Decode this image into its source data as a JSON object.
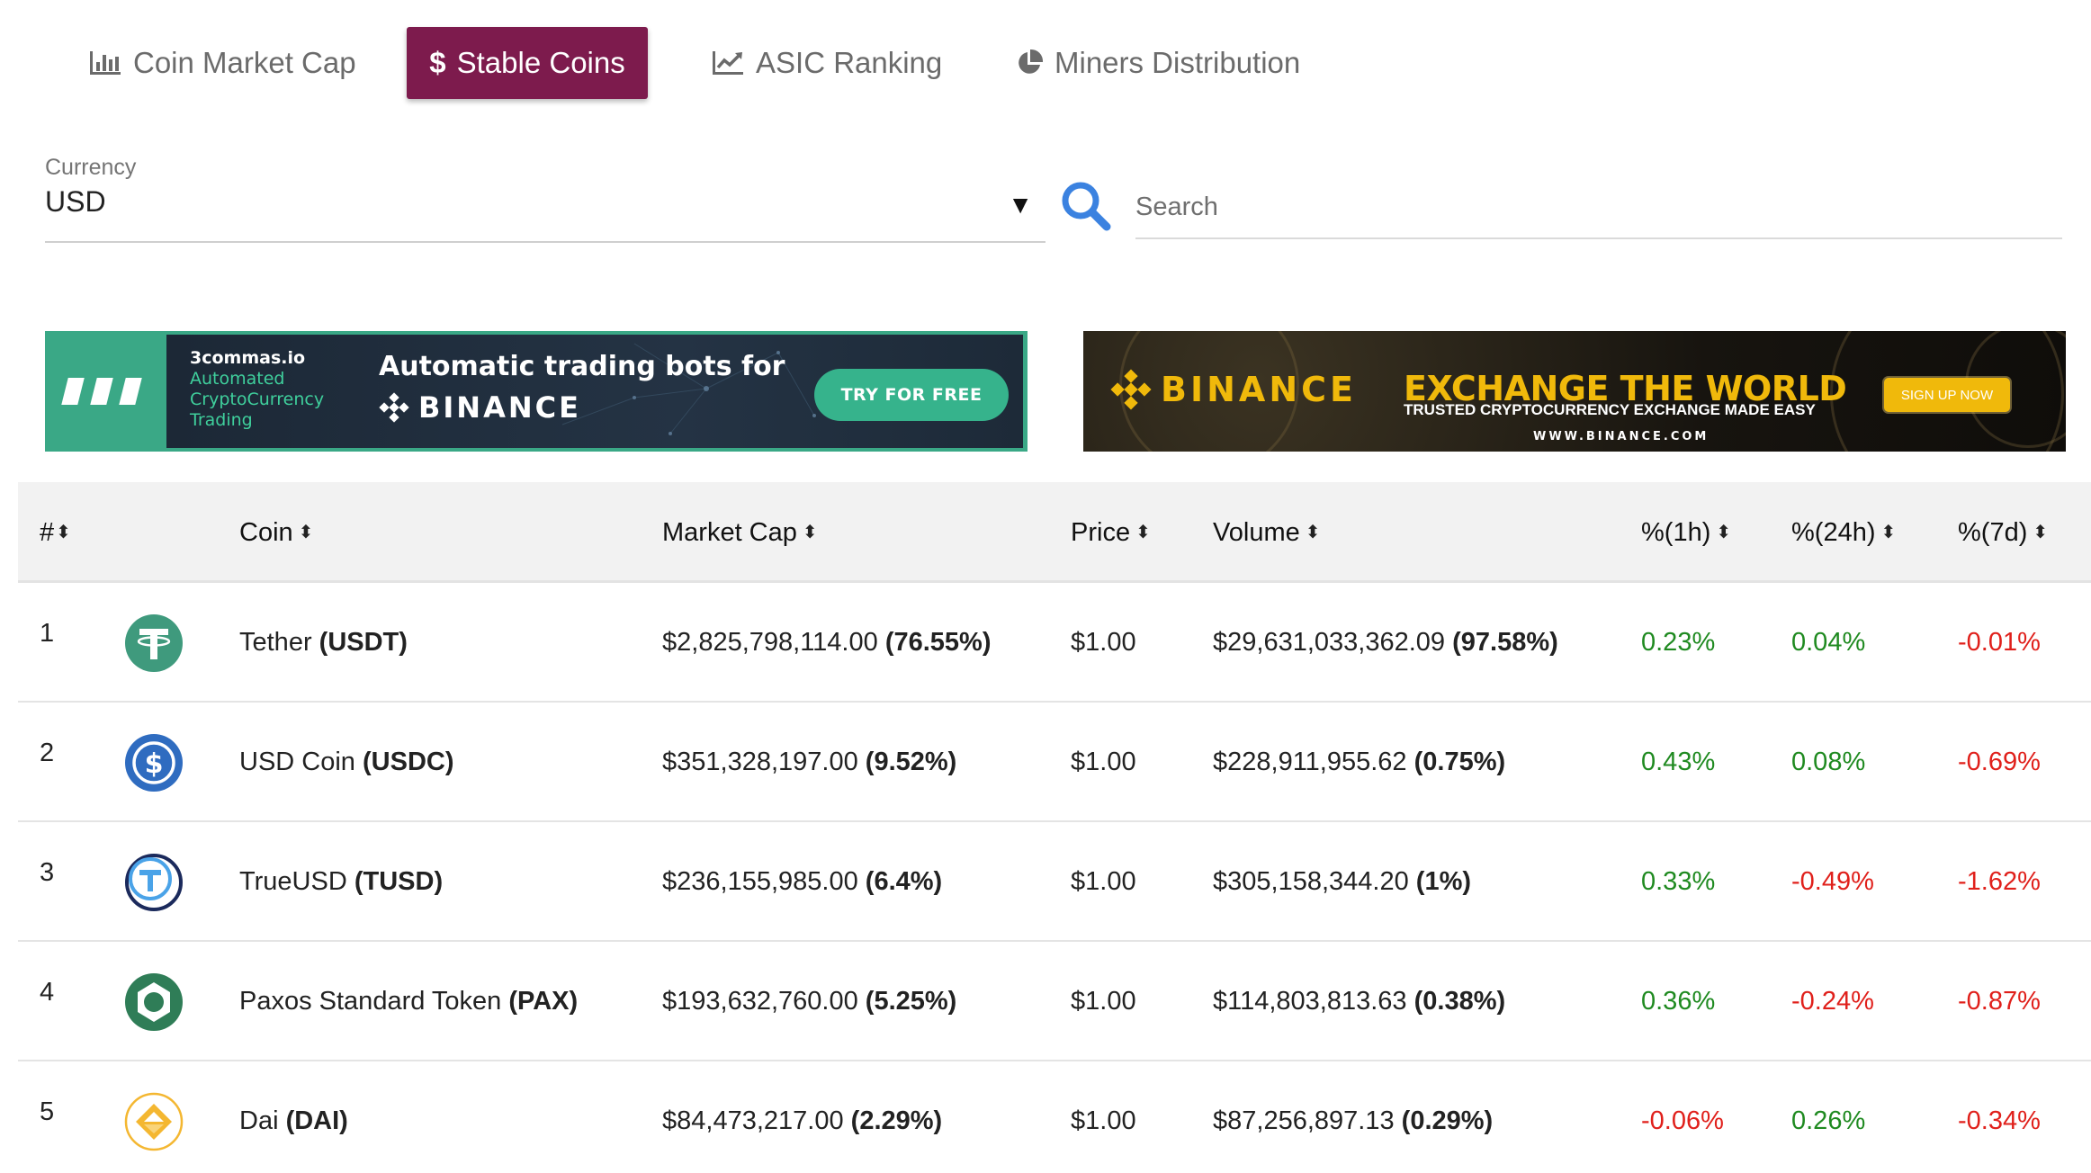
{
  "tabs": [
    {
      "label": "Coin Market Cap",
      "icon": "bar-chart-icon",
      "active": false
    },
    {
      "label": "Stable Coins",
      "icon": "dollar-icon",
      "active": true
    },
    {
      "label": "ASIC Ranking",
      "icon": "line-chart-icon",
      "active": false
    },
    {
      "label": "Miners Distribution",
      "icon": "pie-chart-icon",
      "active": false
    }
  ],
  "currency": {
    "label": "Currency",
    "value": "USD"
  },
  "search": {
    "placeholder": "Search",
    "value": ""
  },
  "ads": {
    "threecommas": {
      "brand": "3commas.io",
      "tagline": "Automated CryptoCurrency Trading",
      "headline": "Automatic trading bots for",
      "partner": "BINANCE",
      "cta": "TRY FOR FREE"
    },
    "binance": {
      "brand": "BINANCE",
      "headline": "EXCHANGE THE WORLD",
      "sub": "TRUSTED CRYPTOCURRENCY EXCHANGE MADE EASY",
      "site": "WWW.BINANCE.COM",
      "cta": "SIGN UP NOW"
    }
  },
  "table": {
    "headers": {
      "rank": "#",
      "coin": "Coin",
      "market_cap": "Market Cap",
      "price": "Price",
      "volume": "Volume",
      "h1": "%(1h)",
      "h24": "%(24h)",
      "d7": "%(7d)"
    },
    "rows": [
      {
        "rank": "1",
        "name": "Tether",
        "symbol": "(USDT)",
        "logo": "tether-icon",
        "market_cap": "$2,825,798,114.00",
        "market_cap_pct": "(76.55%)",
        "price": "$1.00",
        "volume": "$29,631,033,362.09",
        "volume_pct": "(97.58%)",
        "h1": "0.23%",
        "h24": "0.04%",
        "d7": "-0.01%"
      },
      {
        "rank": "2",
        "name": "USD Coin",
        "symbol": "(USDC)",
        "logo": "usd-coin-icon",
        "market_cap": "$351,328,197.00",
        "market_cap_pct": "(9.52%)",
        "price": "$1.00",
        "volume": "$228,911,955.62",
        "volume_pct": "(0.75%)",
        "h1": "0.43%",
        "h24": "0.08%",
        "d7": "-0.69%"
      },
      {
        "rank": "3",
        "name": "TrueUSD",
        "symbol": "(TUSD)",
        "logo": "trueusd-icon",
        "market_cap": "$236,155,985.00",
        "market_cap_pct": "(6.4%)",
        "price": "$1.00",
        "volume": "$305,158,344.20",
        "volume_pct": "(1%)",
        "h1": "0.33%",
        "h24": "-0.49%",
        "d7": "-1.62%"
      },
      {
        "rank": "4",
        "name": "Paxos Standard Token",
        "symbol": "(PAX)",
        "logo": "paxos-icon",
        "market_cap": "$193,632,760.00",
        "market_cap_pct": "(5.25%)",
        "price": "$1.00",
        "volume": "$114,803,813.63",
        "volume_pct": "(0.38%)",
        "h1": "0.36%",
        "h24": "-0.24%",
        "d7": "-0.87%"
      },
      {
        "rank": "5",
        "name": "Dai",
        "symbol": "(DAI)",
        "logo": "dai-icon",
        "market_cap": "$84,473,217.00",
        "market_cap_pct": "(2.29%)",
        "price": "$1.00",
        "volume": "$87,256,897.13",
        "volume_pct": "(0.29%)",
        "h1": "-0.06%",
        "h24": "0.26%",
        "d7": "-0.34%"
      }
    ]
  },
  "colors": {
    "active_tab": "#7d1b4d",
    "positive": "#1f8a20",
    "negative": "#e0201b",
    "search_icon": "#3b82e0",
    "binance_yellow": "#f0b90b",
    "threecommas_green": "#3aa886"
  }
}
